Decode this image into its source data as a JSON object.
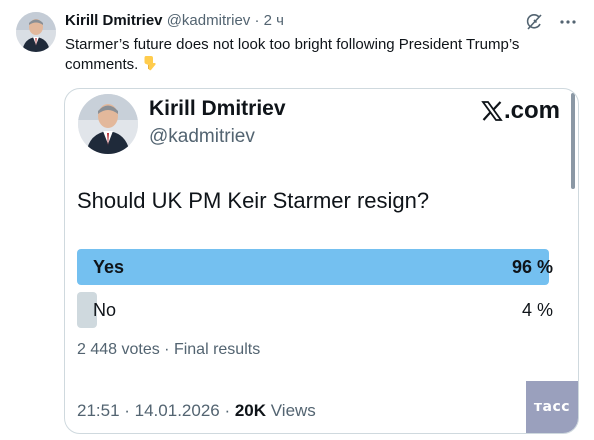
{
  "author": {
    "name": "Kirill Dmitriev",
    "handle": "@kadmitriev",
    "separator": "·",
    "time": "2 ч"
  },
  "tweet": {
    "text": "Starmer’s future does not look too bright following President Trump’s comments."
  },
  "icons": {
    "grok": "grok-icon",
    "more": "more-icon",
    "emoji": "pointing-down-emoji"
  },
  "embed": {
    "name": "Kirill Dmitriev",
    "handle": "@kadmitriev",
    "brand": ".com",
    "question": "Should UK PM Keir Starmer resign?",
    "options": [
      {
        "label": "Yes",
        "percent": "96 %",
        "share": 0.96
      },
      {
        "label": "No",
        "percent": "4 %",
        "share": 0.04
      }
    ],
    "votes": "2 448 votes · Final results",
    "time": "21:51 · 14.01.2026 · ",
    "views_count": "20K",
    "views_label": " Views"
  },
  "watermark": {
    "text": "тасс"
  },
  "colors": {
    "bar_winner": "#74c0f0",
    "bar_loser": "#cfd9de",
    "text_secondary": "#536471",
    "watermark_bg": "#9aa0bd"
  }
}
